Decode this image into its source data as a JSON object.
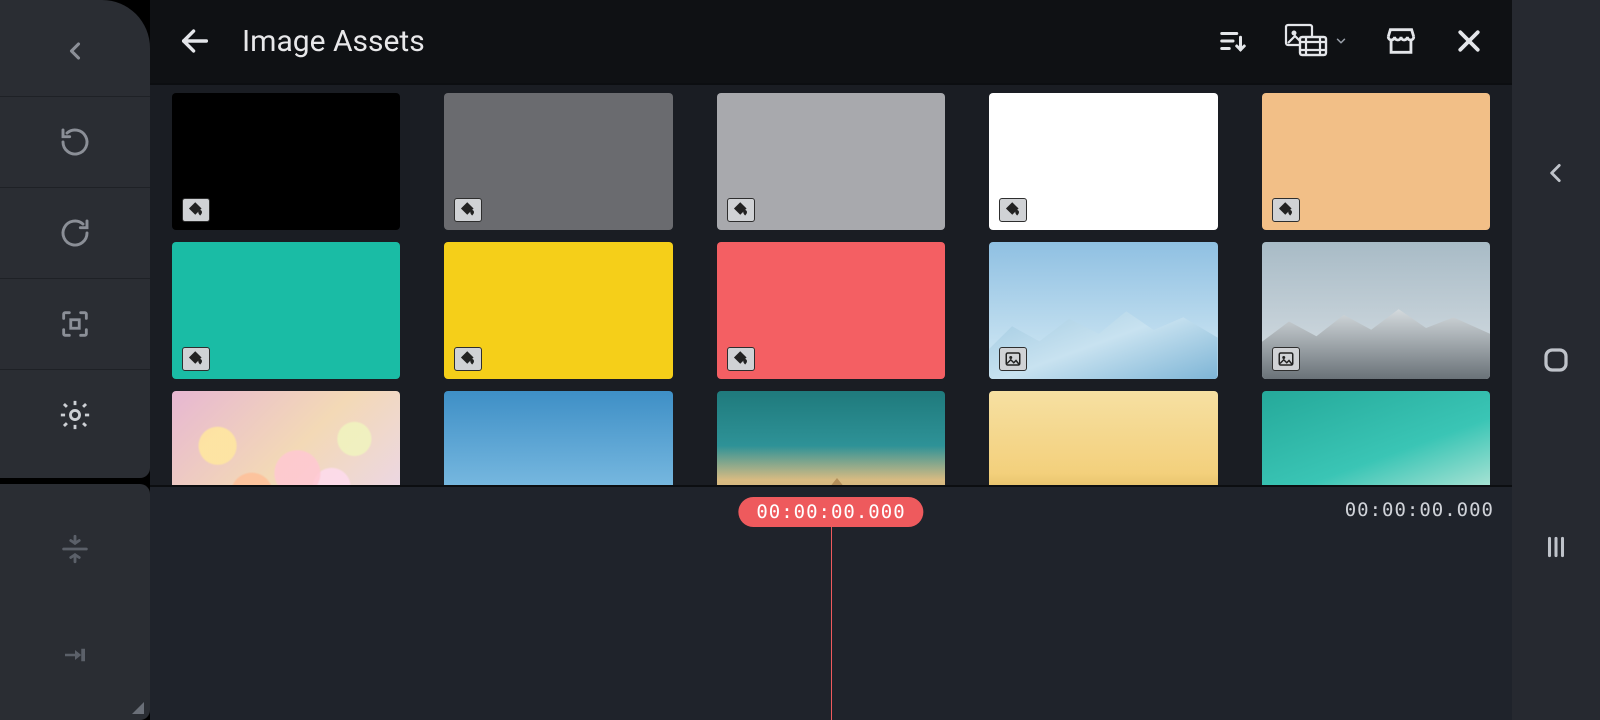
{
  "header": {
    "title": "Image Assets"
  },
  "timeline": {
    "playhead": "00:00:00.000",
    "duration": "00:00:00.000"
  },
  "thumbnails": [
    {
      "kind": "solid",
      "color": "#000000",
      "badge": "fill"
    },
    {
      "kind": "solid",
      "color": "#6a6b6f",
      "badge": "fill"
    },
    {
      "kind": "solid",
      "color": "#a8a9ad",
      "badge": "fill"
    },
    {
      "kind": "solid",
      "color": "#ffffff",
      "badge": "fill"
    },
    {
      "kind": "solid",
      "color": "#f2bf87",
      "badge": "fill"
    },
    {
      "kind": "solid",
      "color": "#1abca5",
      "badge": "fill"
    },
    {
      "kind": "solid",
      "color": "#f5cf19",
      "badge": "fill"
    },
    {
      "kind": "solid",
      "color": "#f45f63",
      "badge": "fill"
    },
    {
      "kind": "image",
      "style": "poly-mountains",
      "badge": "image"
    },
    {
      "kind": "image",
      "style": "snow-mountains",
      "badge": "image"
    },
    {
      "kind": "image",
      "style": "bokeh",
      "badge": "none"
    },
    {
      "kind": "image",
      "style": "sky",
      "badge": "none"
    },
    {
      "kind": "image",
      "style": "desert",
      "badge": "none"
    },
    {
      "kind": "image",
      "style": "sunset",
      "badge": "none"
    },
    {
      "kind": "image",
      "style": "wave",
      "badge": "none"
    }
  ],
  "icons": {
    "sort": "sort-icon",
    "media_picker": "media-picker-icon",
    "store": "store-icon",
    "close": "close-icon"
  }
}
